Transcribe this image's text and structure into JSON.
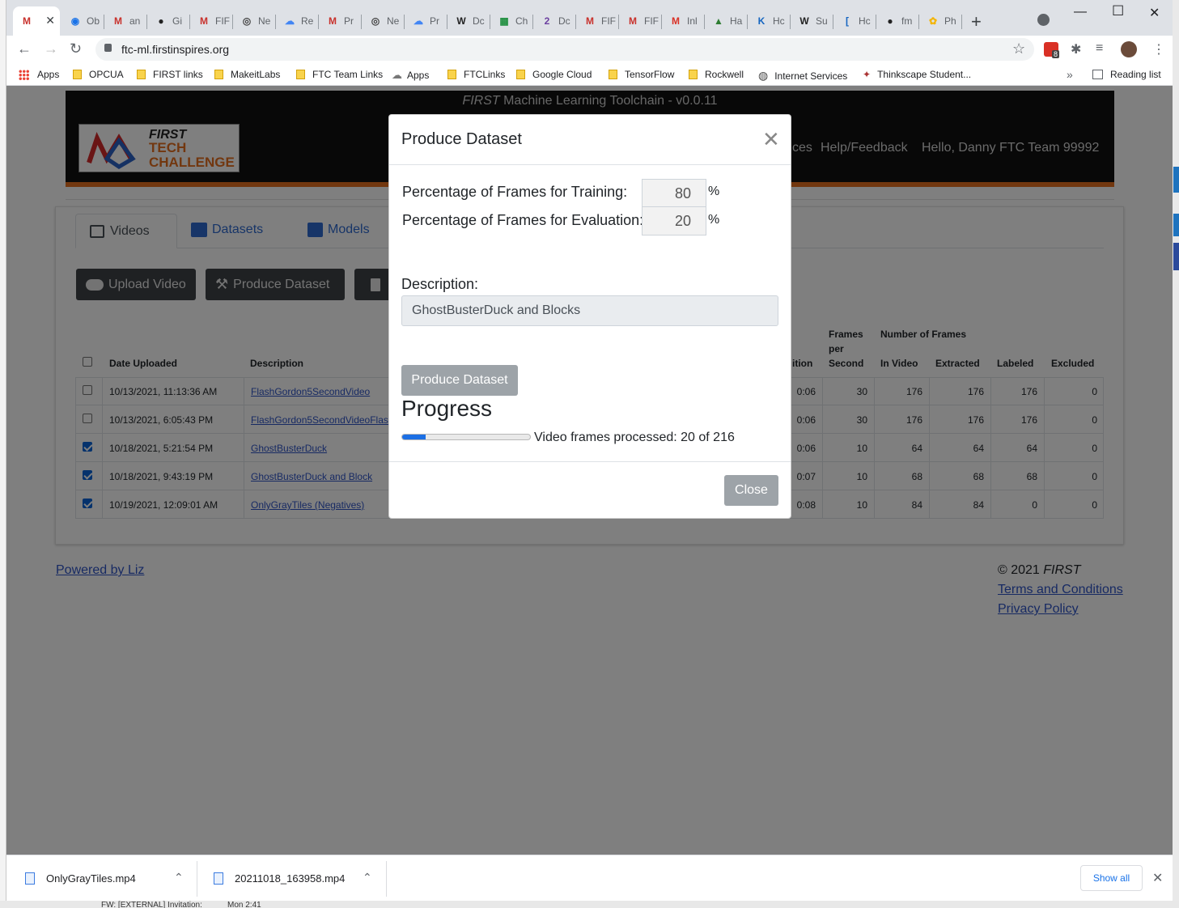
{
  "browser": {
    "active_tab_close": "✕",
    "tabs": [
      {
        "label": "",
        "icon": "first-ml-icon"
      },
      {
        "label": "Ob",
        "icon": "record-icon"
      },
      {
        "label": "an",
        "icon": "first-ml-icon"
      },
      {
        "label": "Gi",
        "icon": "github-icon"
      },
      {
        "label": "FIF",
        "icon": "first-ml-icon"
      },
      {
        "label": "Ne",
        "icon": "chrome-icon"
      },
      {
        "label": "Re",
        "icon": "cloud-icon"
      },
      {
        "label": "Pr",
        "icon": "first-ml-icon"
      },
      {
        "label": "Ne",
        "icon": "chrome-icon"
      },
      {
        "label": "Pr",
        "icon": "cloud-icon"
      },
      {
        "label": "Dc",
        "icon": "wikipedia-icon"
      },
      {
        "label": "Ch",
        "icon": "calculator-icon"
      },
      {
        "label": "Dc",
        "icon": "document-icon"
      },
      {
        "label": "FIF",
        "icon": "first-ml-icon"
      },
      {
        "label": "FIF",
        "icon": "first-ml-icon"
      },
      {
        "label": "Inl",
        "icon": "gmail-icon"
      },
      {
        "label": "Ha",
        "icon": "image-icon"
      },
      {
        "label": "Hc",
        "icon": "k-icon"
      },
      {
        "label": "Su",
        "icon": "wikipedia-icon"
      },
      {
        "label": "Hc",
        "icon": "bracket-icon"
      },
      {
        "label": "fm",
        "icon": "github-icon"
      },
      {
        "label": "Ph",
        "icon": "photos-icon"
      }
    ],
    "url": "ftc-ml.firstinspires.org",
    "extension_badge": "8",
    "bookmarks": [
      {
        "label": "Apps",
        "icon": "apps-grid-icon"
      },
      {
        "label": "OPCUA",
        "icon": "folder-icon"
      },
      {
        "label": "FIRST links",
        "icon": "folder-icon"
      },
      {
        "label": "MakeitLabs",
        "icon": "folder-icon"
      },
      {
        "label": "FTC Team Links",
        "icon": "folder-icon"
      },
      {
        "label": "Apps",
        "icon": "apps-link-icon"
      },
      {
        "label": "FTCLinks",
        "icon": "folder-icon"
      },
      {
        "label": "Google Cloud",
        "icon": "folder-icon"
      },
      {
        "label": "TensorFlow",
        "icon": "folder-icon"
      },
      {
        "label": "Rockwell",
        "icon": "folder-icon"
      },
      {
        "label": "Internet Services",
        "icon": "globe-icon"
      },
      {
        "label": "Thinkscape Student...",
        "icon": "brain-icon"
      }
    ],
    "overflow": "»",
    "reading_list": "Reading list"
  },
  "site": {
    "title_italic": "FIRST",
    "title_rest": " Machine Learning Toolchain - v0.0.11",
    "logo": {
      "first": "FIRST",
      "tech": "TECH",
      "challenge": "CHALLENGE"
    },
    "nav_partial": "ces",
    "nav_help": "Help/Feedback",
    "greeting": "Hello, Danny FTC Team 99992"
  },
  "page_tabs": [
    {
      "label": "Videos",
      "icon": "video-icon"
    },
    {
      "label": "Datasets",
      "icon": "images-icon"
    },
    {
      "label": "Models",
      "icon": "model-icon"
    }
  ],
  "buttons": {
    "upload": "Upload Video",
    "produce": "Produce Dataset"
  },
  "table": {
    "headers": {
      "date": "Date Uploaded",
      "description": "Description",
      "duration_partial": "ition",
      "fps_line1": "Frames",
      "fps_line2": "per",
      "fps_line3": "Second",
      "number_of_frames": "Number of Frames",
      "in_video": "In Video",
      "extracted": "Extracted",
      "labeled": "Labeled",
      "excluded": "Excluded"
    },
    "rows": [
      {
        "checked": false,
        "date": "10/13/2021, 11:13:36 AM",
        "description": "FlashGordon5SecondVideo",
        "duration": "0:06",
        "fps": "30",
        "in_video": "176",
        "extracted": "176",
        "labeled": "176",
        "excluded": "0"
      },
      {
        "checked": false,
        "date": "10/13/2021, 6:05:43 PM",
        "description": "FlashGordon5SecondVideoFlash",
        "duration": "0:06",
        "fps": "30",
        "in_video": "176",
        "extracted": "176",
        "labeled": "176",
        "excluded": "0"
      },
      {
        "checked": true,
        "date": "10/18/2021, 5:21:54 PM",
        "description": "GhostBusterDuck",
        "duration": "0:06",
        "fps": "10",
        "in_video": "64",
        "extracted": "64",
        "labeled": "64",
        "excluded": "0"
      },
      {
        "checked": true,
        "date": "10/18/2021, 9:43:19 PM",
        "description": "GhostBusterDuck and Block",
        "duration": "0:07",
        "fps": "10",
        "in_video": "68",
        "extracted": "68",
        "labeled": "68",
        "excluded": "0"
      },
      {
        "checked": true,
        "date": "10/19/2021, 12:09:01 AM",
        "description": "OnlyGrayTiles (Negatives)",
        "duration": "0:08",
        "fps": "10",
        "in_video": "84",
        "extracted": "84",
        "labeled": "0",
        "excluded": "0"
      }
    ]
  },
  "footer": {
    "powered": "Powered by Liz",
    "copyright": "© 2021 ",
    "copyright_italic": "FIRST",
    "terms": "Terms and Conditions",
    "privacy": "Privacy Policy"
  },
  "modal": {
    "title": "Produce Dataset",
    "close_x": "✕",
    "training_label": "Percentage of Frames for Training:",
    "training_value": "80",
    "evaluation_label": "Percentage of Frames for Evaluation:",
    "evaluation_value": "20",
    "percent_sign": "%",
    "description_label": "Description:",
    "description_value": "GhostBusterDuck and Blocks",
    "produce_button": "Produce Dataset",
    "progress_heading": "Progress",
    "progress_fraction": 0.1852,
    "progress_text": "Video frames processed: 20 of 216",
    "close_button": "Close"
  },
  "downloads": {
    "items": [
      {
        "name": "OnlyGrayTiles.mp4"
      },
      {
        "name": "20211018_163958.mp4"
      }
    ],
    "show_all": "Show all"
  },
  "background_text": {
    "email_partial": "FW: [EXTERNAL] Invitation:",
    "time_partial": "Mon 2:41"
  }
}
